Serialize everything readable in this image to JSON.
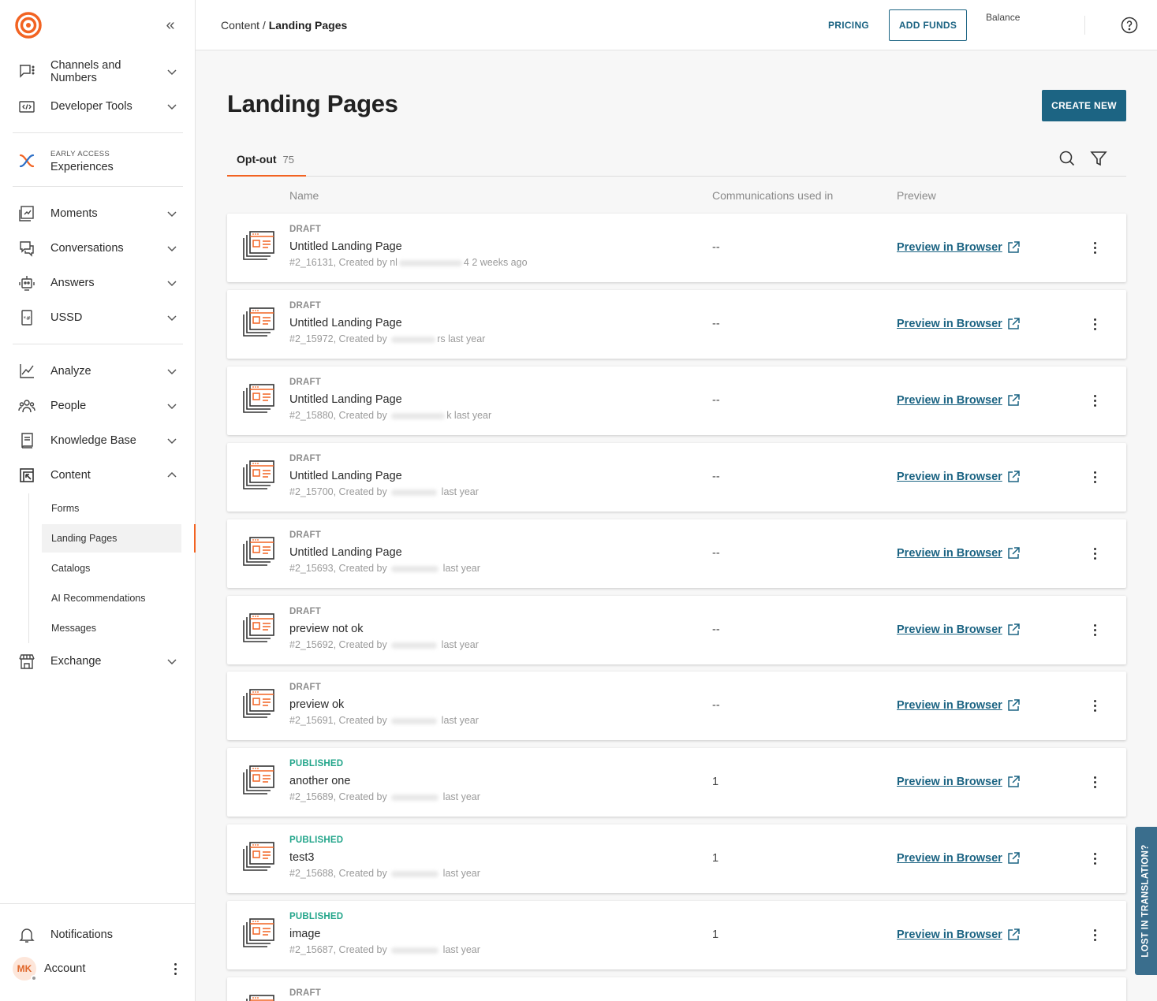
{
  "sidebar": {
    "groups": [
      {
        "label": "Channels and Numbers",
        "icon": "chat-numbers-icon"
      },
      {
        "label": "Developer Tools",
        "icon": "code-icon"
      }
    ],
    "experiences": {
      "badge": "EARLY ACCESS",
      "label": "Experiences"
    },
    "items": [
      {
        "label": "Moments"
      },
      {
        "label": "Conversations"
      },
      {
        "label": "Answers"
      },
      {
        "label": "USSD"
      },
      {
        "label": "Analyze"
      },
      {
        "label": "People"
      },
      {
        "label": "Knowledge Base"
      },
      {
        "label": "Content"
      },
      {
        "label": "Exchange"
      }
    ],
    "content_sub": [
      {
        "label": "Forms"
      },
      {
        "label": "Landing Pages"
      },
      {
        "label": "Catalogs"
      },
      {
        "label": "AI Recommendations"
      },
      {
        "label": "Messages"
      }
    ],
    "notifications": "Notifications",
    "account": {
      "initials": "MK",
      "label": "Account"
    }
  },
  "topbar": {
    "breadcrumb_parent": "Content",
    "breadcrumb_sep": " / ",
    "breadcrumb_current": "Landing Pages",
    "pricing": "PRICING",
    "add_funds": "ADD FUNDS",
    "balance": "Balance"
  },
  "main": {
    "title": "Landing Pages",
    "create_new": "CREATE NEW",
    "tab": {
      "label": "Opt-out",
      "count": "75"
    },
    "columns": {
      "name": "Name",
      "communications": "Communications used in",
      "preview": "Preview"
    },
    "preview_label": "Preview in Browser",
    "rows": [
      {
        "status": "DRAFT",
        "name": "Untitled Landing Page",
        "id_prefix": "#2_16131, Created by ",
        "visible_user_start": "nl",
        "visible_user_end": "4",
        "when": " 2 weeks ago",
        "comm": "--"
      },
      {
        "status": "DRAFT",
        "name": "Untitled Landing Page",
        "id_prefix": "#2_15972, Created by ",
        "visible_user_start": "",
        "visible_user_end": "rs",
        "when": " last year",
        "comm": "--"
      },
      {
        "status": "DRAFT",
        "name": "Untitled Landing Page",
        "id_prefix": "#2_15880, Created by ",
        "visible_user_start": "",
        "visible_user_end": "k",
        "when": " last year",
        "comm": "--"
      },
      {
        "status": "DRAFT",
        "name": "Untitled Landing Page",
        "id_prefix": "#2_15700, Created by ",
        "visible_user_start": "",
        "visible_user_end": "",
        "when": " last year",
        "comm": "--"
      },
      {
        "status": "DRAFT",
        "name": "Untitled Landing Page",
        "id_prefix": "#2_15693, Created by ",
        "visible_user_start": "",
        "visible_user_end": "",
        "when": " last year",
        "comm": "--"
      },
      {
        "status": "DRAFT",
        "name": "preview not ok",
        "id_prefix": "#2_15692, Created by ",
        "visible_user_start": "",
        "visible_user_end": "",
        "when": " last year",
        "comm": "--"
      },
      {
        "status": "DRAFT",
        "name": "preview ok",
        "id_prefix": "#2_15691, Created by ",
        "visible_user_start": "",
        "visible_user_end": "",
        "when": " last year",
        "comm": "--"
      },
      {
        "status": "PUBLISHED",
        "name": "another one",
        "id_prefix": "#2_15689, Created by ",
        "visible_user_start": "",
        "visible_user_end": "",
        "when": " last year",
        "comm": "1"
      },
      {
        "status": "PUBLISHED",
        "name": "test3",
        "id_prefix": "#2_15688, Created by ",
        "visible_user_start": "",
        "visible_user_end": "",
        "when": " last year",
        "comm": "1"
      },
      {
        "status": "PUBLISHED",
        "name": "image",
        "id_prefix": "#2_15687, Created by ",
        "visible_user_start": "",
        "visible_user_end": "",
        "when": " last year",
        "comm": "1"
      },
      {
        "status": "DRAFT",
        "name": "",
        "id_prefix": "",
        "visible_user_start": "",
        "visible_user_end": "",
        "when": "",
        "comm": ""
      }
    ]
  },
  "feedback_tab": "LOST IN TRANSLATION?",
  "colors": {
    "accent": "#f26322",
    "primary": "#1c6483",
    "published": "#22a58a",
    "draft": "#8d8d8d"
  }
}
